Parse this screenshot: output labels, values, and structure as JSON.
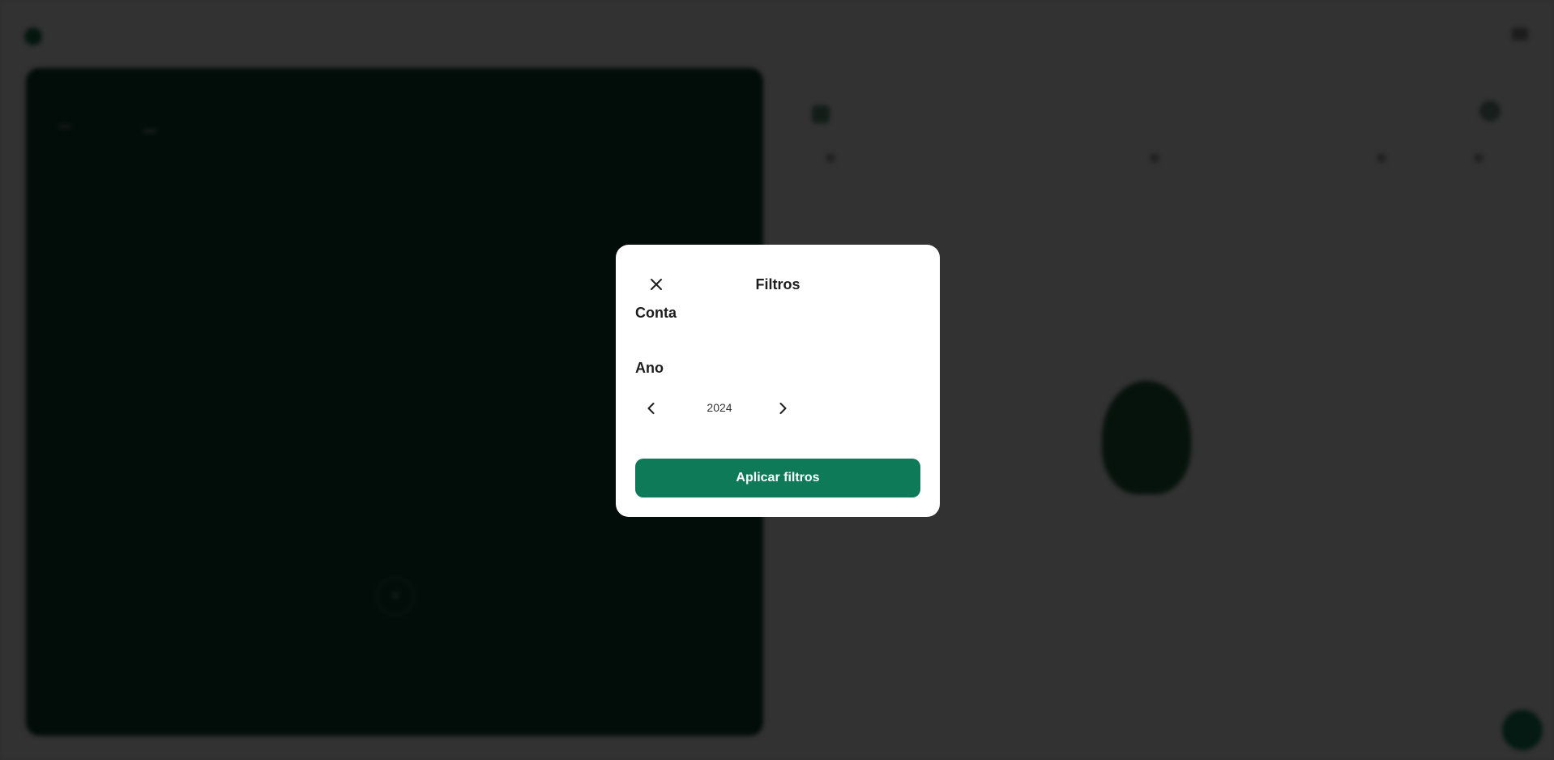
{
  "colors": {
    "accent": "#0e7a58",
    "overlay": "rgba(0,0,0,0.79)",
    "card": "#0b3a2a"
  },
  "background_icons": {
    "topbar_right": "grid-icon",
    "filter": "filter-icon"
  },
  "modal": {
    "title": "Filtros",
    "close_icon": "close-icon",
    "account_label": "Conta",
    "year_label": "Ano",
    "year_value": "2024",
    "prev_icon": "chevron-left-icon",
    "next_icon": "chevron-right-icon",
    "apply_label": "Aplicar filtros"
  }
}
